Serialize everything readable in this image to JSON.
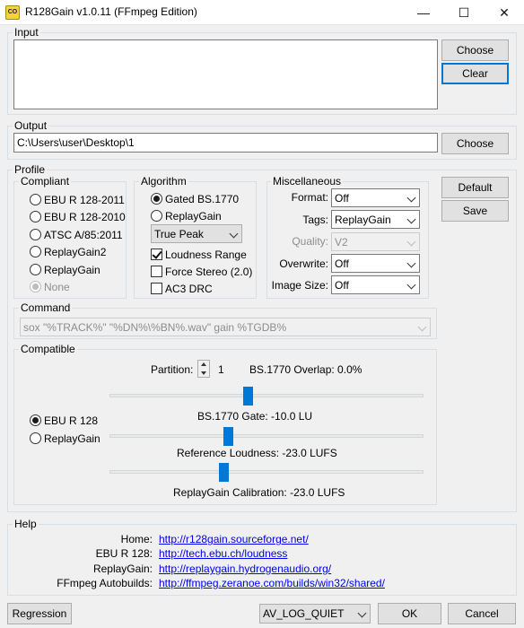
{
  "window": {
    "title": "R128Gain v1.0.11 (FFmpeg Edition)",
    "app_icon_text": "CO",
    "minimize_glyph": "—",
    "maximize_glyph": "☐",
    "close_glyph": "✕"
  },
  "input": {
    "group_title": "Input",
    "choose_label": "Choose",
    "clear_label": "Clear"
  },
  "output": {
    "group_title": "Output",
    "path_value": "C:\\Users\\user\\Desktop\\1",
    "choose_label": "Choose"
  },
  "profile": {
    "group_title": "Profile",
    "default_label": "Default",
    "save_label": "Save",
    "compliant": {
      "title": "Compliant",
      "options": [
        {
          "label": "EBU R 128-2011",
          "checked": false,
          "disabled": false
        },
        {
          "label": "EBU R 128-2010",
          "checked": false,
          "disabled": false
        },
        {
          "label": "ATSC A/85:2011",
          "checked": false,
          "disabled": false
        },
        {
          "label": "ReplayGain2",
          "checked": false,
          "disabled": false
        },
        {
          "label": "ReplayGain",
          "checked": false,
          "disabled": false
        },
        {
          "label": "None",
          "checked": true,
          "disabled": true
        }
      ]
    },
    "algorithm": {
      "title": "Algorithm",
      "gated_label": "Gated BS.1770",
      "replaygain_label": "ReplayGain",
      "peak_select": "True Peak",
      "loudness_range_label": "Loudness Range",
      "loudness_range_checked": true,
      "force_stereo_label": "Force Stereo (2.0)",
      "force_stereo_checked": false,
      "ac3_drc_label": "AC3 DRC",
      "ac3_drc_checked": false
    },
    "misc": {
      "title": "Miscellaneous",
      "format_label": "Format:",
      "format_value": "Off",
      "tags_label": "Tags:",
      "tags_value": "ReplayGain",
      "quality_label": "Quality:",
      "quality_value": "V2",
      "overwrite_label": "Overwrite:",
      "overwrite_value": "Off",
      "image_size_label": "Image Size:",
      "image_size_value": "Off"
    },
    "command": {
      "title": "Command",
      "value": "sox \"%TRACK%\" \"%DN%\\%BN%.wav\" gain %TGDB%"
    },
    "compatible": {
      "title": "Compatible",
      "partition_label": "Partition:",
      "partition_value": "1",
      "overlap_label": "BS.1770 Overlap: 0.0%",
      "ebu_label": "EBU R 128",
      "ebu_checked": true,
      "replaygain_label": "ReplayGain",
      "replaygain_checked": false,
      "gate_label": "BS.1770 Gate: -10.0 LU",
      "gate_fraction": 0.44,
      "reference_label": "Reference Loudness: -23.0 LUFS",
      "reference_fraction": 0.375,
      "calibration_label": "ReplayGain Calibration: -23.0 LUFS",
      "calibration_fraction": 0.36
    }
  },
  "help": {
    "group_title": "Help",
    "rows": [
      {
        "label": "Home:",
        "link": "http://r128gain.sourceforge.net/"
      },
      {
        "label": "EBU R 128:",
        "link": "http://tech.ebu.ch/loudness"
      },
      {
        "label": "ReplayGain:",
        "link": "http://replaygain.hydrogenaudio.org/"
      },
      {
        "label": "FFmpeg Autobuilds:",
        "link": "http://ffmpeg.zeranoe.com/builds/win32/shared/"
      }
    ]
  },
  "footer": {
    "regression_label": "Regression",
    "log_level_value": "AV_LOG_QUIET",
    "ok_label": "OK",
    "cancel_label": "Cancel"
  }
}
